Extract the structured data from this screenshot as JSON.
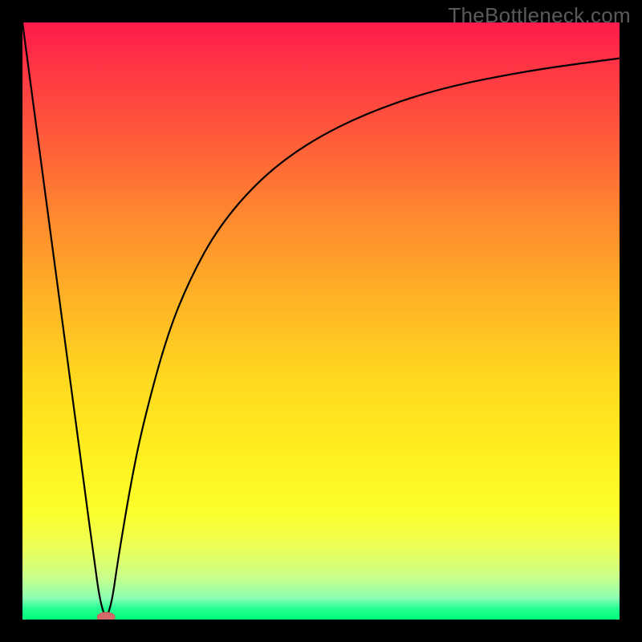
{
  "watermark": "TheBottleneck.com",
  "chart_data": {
    "type": "line",
    "title": "",
    "xlabel": "",
    "ylabel": "",
    "xlim": [
      0,
      100
    ],
    "ylim": [
      0,
      100
    ],
    "legend": false,
    "grid": false,
    "background_gradient": {
      "direction": "top-to-bottom",
      "stops": [
        {
          "pos": 0.0,
          "color": "#ff1a4b"
        },
        {
          "pos": 0.33,
          "color": "#ff8a2f"
        },
        {
          "pos": 0.6,
          "color": "#ffd91f"
        },
        {
          "pos": 0.88,
          "color": "#ecff58"
        },
        {
          "pos": 1.0,
          "color": "#00ff7a"
        }
      ]
    },
    "series": [
      {
        "name": "bottleneck-curve",
        "x": [
          0,
          2,
          4,
          6,
          8,
          10,
          12,
          13,
          14,
          15,
          16,
          18,
          20,
          24,
          28,
          33,
          40,
          48,
          58,
          70,
          85,
          100
        ],
        "y": [
          100,
          85,
          70,
          55,
          40,
          25,
          10,
          3,
          0,
          3,
          10,
          22,
          32,
          47,
          57,
          66,
          74,
          80,
          85,
          89,
          92,
          94
        ]
      }
    ],
    "marker": {
      "x": 14,
      "y": 0,
      "shape": "ellipse",
      "color": "#d46a6a"
    }
  }
}
